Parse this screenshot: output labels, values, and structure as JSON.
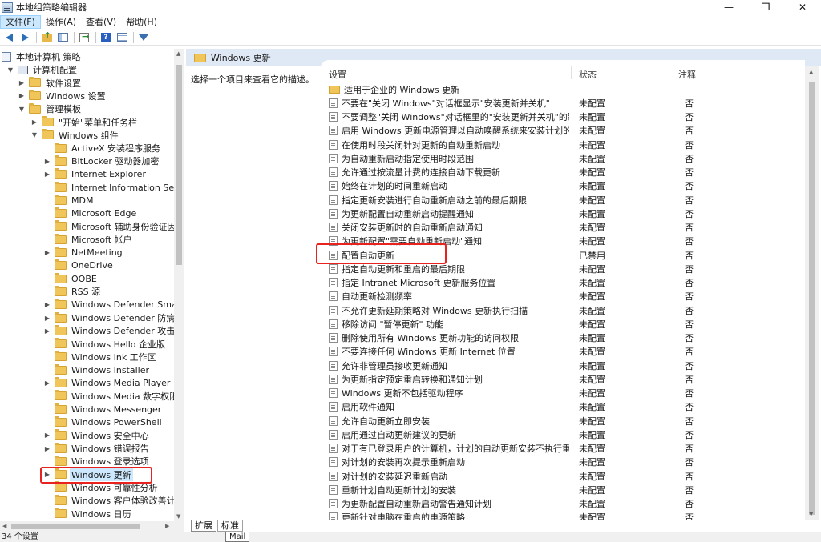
{
  "window": {
    "title": "本地组策略编辑器",
    "minimize": "—",
    "maximize": "❐",
    "close": "✕"
  },
  "menu": [
    "文件(F)",
    "操作(A)",
    "查看(V)",
    "帮助(H)"
  ],
  "tree": [
    {
      "label": "本地计算机 策略",
      "level": 0,
      "expander": "",
      "icon": "policy"
    },
    {
      "label": "计算机配置",
      "level": 1,
      "expander": "open",
      "icon": "pc"
    },
    {
      "label": "软件设置",
      "level": 2,
      "expander": "closed",
      "icon": "folder"
    },
    {
      "label": "Windows 设置",
      "level": 2,
      "expander": "closed",
      "icon": "folder"
    },
    {
      "label": "管理模板",
      "level": 2,
      "expander": "open",
      "icon": "folder"
    },
    {
      "label": "\"开始\"菜单和任务栏",
      "level": 3,
      "expander": "closed",
      "icon": "folder"
    },
    {
      "label": "Windows 组件",
      "level": 3,
      "expander": "open",
      "icon": "folder"
    },
    {
      "label": "ActiveX 安装程序服务",
      "level": 4,
      "expander": "",
      "icon": "folder"
    },
    {
      "label": "BitLocker 驱动器加密",
      "level": 4,
      "expander": "closed",
      "icon": "folder"
    },
    {
      "label": "Internet Explorer",
      "level": 4,
      "expander": "closed",
      "icon": "folder"
    },
    {
      "label": "Internet Information Service",
      "level": 4,
      "expander": "",
      "icon": "folder"
    },
    {
      "label": "MDM",
      "level": 4,
      "expander": "",
      "icon": "folder"
    },
    {
      "label": "Microsoft Edge",
      "level": 4,
      "expander": "",
      "icon": "folder"
    },
    {
      "label": "Microsoft 辅助身份验证因素",
      "level": 4,
      "expander": "",
      "icon": "folder"
    },
    {
      "label": "Microsoft 帐户",
      "level": 4,
      "expander": "",
      "icon": "folder"
    },
    {
      "label": "NetMeeting",
      "level": 4,
      "expander": "closed",
      "icon": "folder"
    },
    {
      "label": "OneDrive",
      "level": 4,
      "expander": "",
      "icon": "folder"
    },
    {
      "label": "OOBE",
      "level": 4,
      "expander": "",
      "icon": "folder"
    },
    {
      "label": "RSS 源",
      "level": 4,
      "expander": "",
      "icon": "folder"
    },
    {
      "label": "Windows Defender SmartScr",
      "level": 4,
      "expander": "closed",
      "icon": "folder"
    },
    {
      "label": "Windows Defender 防病毒程",
      "level": 4,
      "expander": "closed",
      "icon": "folder"
    },
    {
      "label": "Windows Defender 攻击防护",
      "level": 4,
      "expander": "closed",
      "icon": "folder"
    },
    {
      "label": "Windows Hello 企业版",
      "level": 4,
      "expander": "",
      "icon": "folder"
    },
    {
      "label": "Windows Ink 工作区",
      "level": 4,
      "expander": "",
      "icon": "folder"
    },
    {
      "label": "Windows Installer",
      "level": 4,
      "expander": "",
      "icon": "folder"
    },
    {
      "label": "Windows Media Player",
      "level": 4,
      "expander": "closed",
      "icon": "folder"
    },
    {
      "label": "Windows Media 数字权限管理",
      "level": 4,
      "expander": "",
      "icon": "folder"
    },
    {
      "label": "Windows Messenger",
      "level": 4,
      "expander": "",
      "icon": "folder"
    },
    {
      "label": "Windows PowerShell",
      "level": 4,
      "expander": "",
      "icon": "folder"
    },
    {
      "label": "Windows 安全中心",
      "level": 4,
      "expander": "closed",
      "icon": "folder"
    },
    {
      "label": "Windows 错误报告",
      "level": 4,
      "expander": "closed",
      "icon": "folder"
    },
    {
      "label": "Windows 登录选项",
      "level": 4,
      "expander": "",
      "icon": "folder"
    },
    {
      "label": "Windows 更新",
      "level": 4,
      "expander": "closed",
      "icon": "folder",
      "selected": true
    },
    {
      "label": "Windows 可靠性分析",
      "level": 4,
      "expander": "",
      "icon": "folder"
    },
    {
      "label": "Windows 客户体验改善计划",
      "level": 4,
      "expander": "",
      "icon": "folder"
    },
    {
      "label": "Windows 日历",
      "level": 4,
      "expander": "",
      "icon": "folder"
    }
  ],
  "right": {
    "header_title": "Windows 更新",
    "description": "选择一个项目来查看它的描述。",
    "columns": {
      "setting": "设置",
      "state": "状态",
      "note": "注释"
    },
    "rows": [
      {
        "name": "适用于企业的 Windows 更新",
        "state": "",
        "note": "",
        "type": "folder"
      },
      {
        "name": "不要在\"关闭 Windows\"对话框显示\"安装更新并关机\"",
        "state": "未配置",
        "note": "否",
        "type": "setting"
      },
      {
        "name": "不要调整\"关闭 Windows\"对话框里的\"安装更新并关机\"的默...",
        "state": "未配置",
        "note": "否",
        "type": "setting"
      },
      {
        "name": "启用 Windows 更新电源管理以自动唤醒系统来安装计划的...",
        "state": "未配置",
        "note": "否",
        "type": "setting"
      },
      {
        "name": "在使用时段关闭针对更新的自动重新启动",
        "state": "未配置",
        "note": "否",
        "type": "setting"
      },
      {
        "name": "为自动重新启动指定使用时段范围",
        "state": "未配置",
        "note": "否",
        "type": "setting"
      },
      {
        "name": "允许通过按流量计费的连接自动下载更新",
        "state": "未配置",
        "note": "否",
        "type": "setting"
      },
      {
        "name": "始终在计划的时间重新启动",
        "state": "未配置",
        "note": "否",
        "type": "setting"
      },
      {
        "name": "指定更新安装进行自动重新启动之前的最后期限",
        "state": "未配置",
        "note": "否",
        "type": "setting"
      },
      {
        "name": "为更新配置自动重新启动提醒通知",
        "state": "未配置",
        "note": "否",
        "type": "setting"
      },
      {
        "name": "关闭安装更新时的自动重新启动通知",
        "state": "未配置",
        "note": "否",
        "type": "setting"
      },
      {
        "name": "为更新配置\"需要自动重新启动\"通知",
        "state": "未配置",
        "note": "否",
        "type": "setting"
      },
      {
        "name": "配置自动更新",
        "state": "已禁用",
        "note": "否",
        "type": "setting"
      },
      {
        "name": "指定自动更新和重启的最后期限",
        "state": "未配置",
        "note": "否",
        "type": "setting"
      },
      {
        "name": "指定 Intranet Microsoft 更新服务位置",
        "state": "未配置",
        "note": "否",
        "type": "setting"
      },
      {
        "name": "自动更新检测频率",
        "state": "未配置",
        "note": "否",
        "type": "setting"
      },
      {
        "name": "不允许更新延期策略对 Windows 更新执行扫描",
        "state": "未配置",
        "note": "否",
        "type": "setting"
      },
      {
        "name": "移除访问 \"暂停更新\" 功能",
        "state": "未配置",
        "note": "否",
        "type": "setting"
      },
      {
        "name": "删除使用所有 Windows 更新功能的访问权限",
        "state": "未配置",
        "note": "否",
        "type": "setting"
      },
      {
        "name": "不要连接任何 Windows 更新 Internet 位置",
        "state": "未配置",
        "note": "否",
        "type": "setting"
      },
      {
        "name": "允许非管理员接收更新通知",
        "state": "未配置",
        "note": "否",
        "type": "setting"
      },
      {
        "name": "为更新指定预定重启转换和通知计划",
        "state": "未配置",
        "note": "否",
        "type": "setting"
      },
      {
        "name": "Windows 更新不包括驱动程序",
        "state": "未配置",
        "note": "否",
        "type": "setting"
      },
      {
        "name": "启用软件通知",
        "state": "未配置",
        "note": "否",
        "type": "setting"
      },
      {
        "name": "允许自动更新立即安装",
        "state": "未配置",
        "note": "否",
        "type": "setting"
      },
      {
        "name": "启用通过自动更新建议的更新",
        "state": "未配置",
        "note": "否",
        "type": "setting"
      },
      {
        "name": "对于有已登录用户的计算机，计划的自动更新安装不执行重...",
        "state": "未配置",
        "note": "否",
        "type": "setting"
      },
      {
        "name": "对计划的安装再次提示重新启动",
        "state": "未配置",
        "note": "否",
        "type": "setting"
      },
      {
        "name": "对计划的安装延迟重新启动",
        "state": "未配置",
        "note": "否",
        "type": "setting"
      },
      {
        "name": "重新计划自动更新计划的安装",
        "state": "未配置",
        "note": "否",
        "type": "setting"
      },
      {
        "name": "为更新配置自动重新启动警告通知计划",
        "state": "未配置",
        "note": "否",
        "type": "setting"
      },
      {
        "name": "更新针对电脑在重启的电源策略",
        "state": "未配置",
        "note": "否",
        "type": "setting"
      }
    ]
  },
  "tabs": [
    "扩展",
    "标准"
  ],
  "status": "34 个设置",
  "tooltip": "Mail"
}
